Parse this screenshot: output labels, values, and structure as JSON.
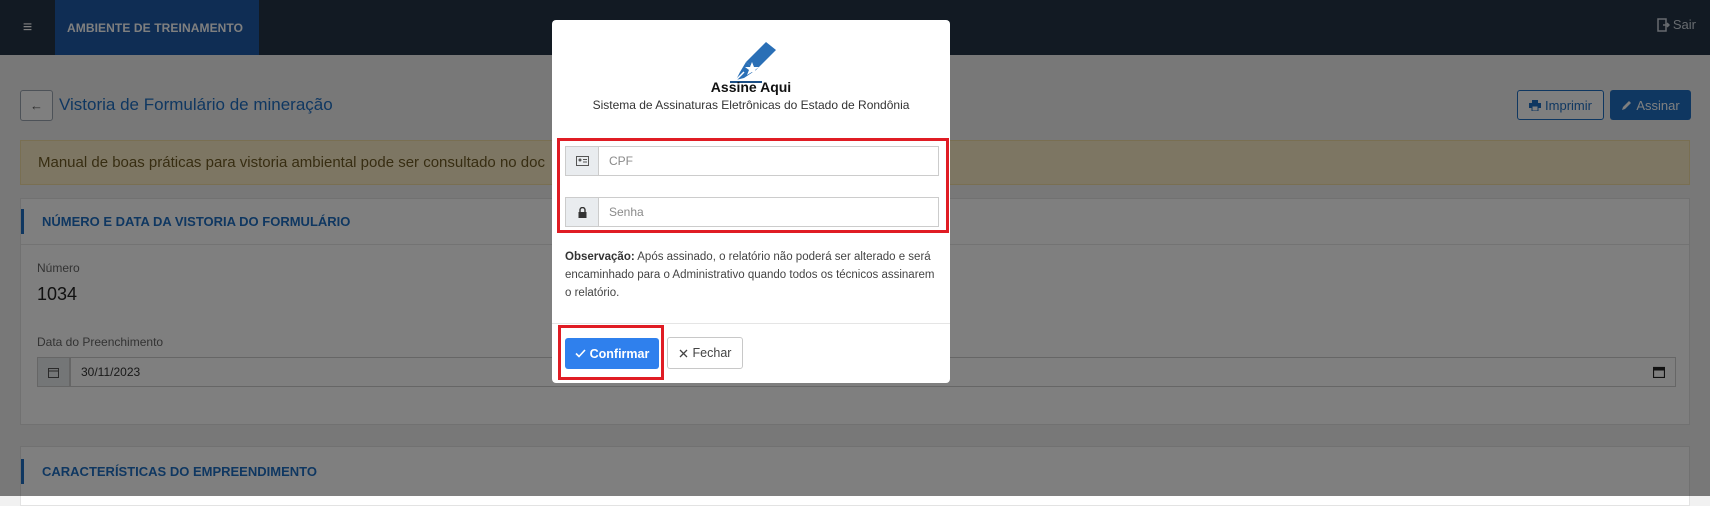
{
  "topbar": {
    "menu_icon": "≡",
    "environment": "AMBIENTE DE TREINAMENTO",
    "logout_label": "Sair"
  },
  "page": {
    "back_icon": "←",
    "title": "Vistoria de Formulário de mineração",
    "print_label": "Imprimir",
    "sign_label": "Assinar",
    "alert_text": "Manual de boas práticas para vistoria ambiental pode ser consultado no doc"
  },
  "section1": {
    "title": "NÚMERO E DATA DA VISTORIA DO FORMULÁRIO",
    "number_label": "Número",
    "number_value": "1034",
    "date_label": "Data do Preenchimento",
    "date_value": "30/11/2023"
  },
  "section2": {
    "title": "CARACTERÍSTICAS DO EMPREENDIMENTO"
  },
  "modal": {
    "brand": "Assine Aqui",
    "subtitle": "Sistema de Assinaturas Eletrônicas do Estado de Rondônia",
    "cpf_placeholder": "CPF",
    "password_placeholder": "Senha",
    "note_label": "Observação:",
    "note_text": " Após assinado, o relatório não poderá ser alterado e será encaminhado para o Administrativo quando todos os técnicos assinarem o relatório.",
    "confirm_label": "Confirmar",
    "close_label": "Fechar"
  },
  "colors": {
    "primary": "#1f6fc3",
    "topbar": "#243447",
    "highlight": "#e01c24",
    "alert_bg": "#fbedc6"
  }
}
